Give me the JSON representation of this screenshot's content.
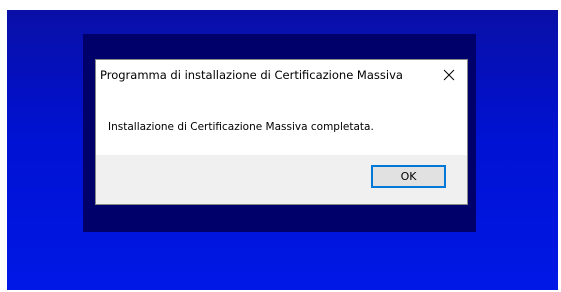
{
  "dialog": {
    "title": "Programma di installazione di Certificazione Massiva",
    "message": "Installazione di Certificazione Massiva completata.",
    "ok_label": "OK",
    "close_icon": "close-icon"
  },
  "colors": {
    "desktop_gradient_top": "#0a0fa6",
    "desktop_gradient_bottom": "#0018e6",
    "installer_frame": "#00006b",
    "button_focus_border": "#0078d7",
    "button_area_bg": "#f0f0f0"
  }
}
